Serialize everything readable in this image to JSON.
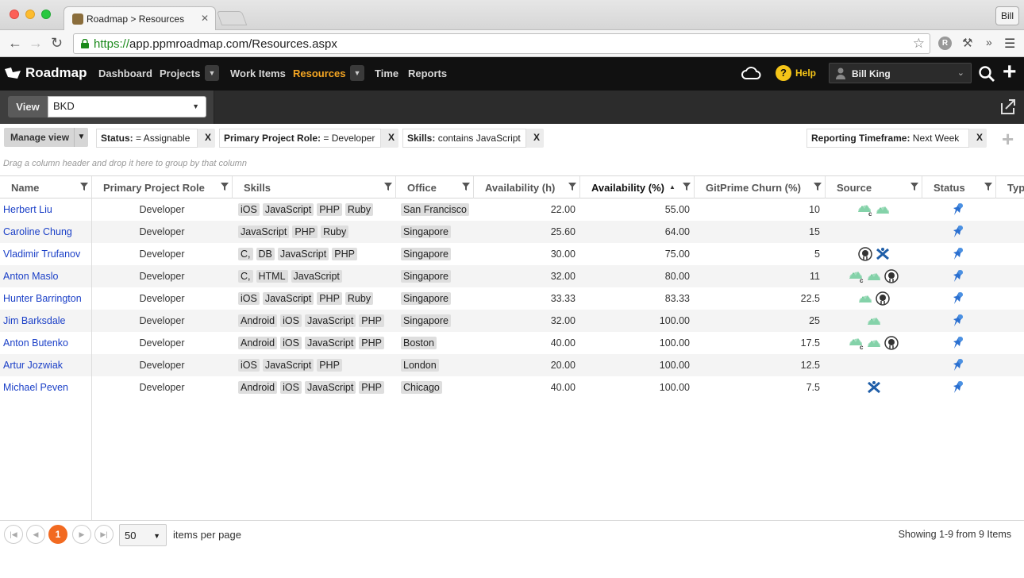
{
  "browser": {
    "tab_title": "Roadmap > Resources",
    "tab_close": "✕",
    "profile": "Bill",
    "url_scheme": "https://",
    "url_rest": "app.ppmroadmap.com/Resources.aspx",
    "ext_badge": "R"
  },
  "app": {
    "logo_text": "Roadmap",
    "nav": [
      {
        "label": "Dashboard"
      },
      {
        "label": "Projects"
      },
      {
        "label": "Work Items"
      },
      {
        "label": "Resources"
      },
      {
        "label": "Time"
      },
      {
        "label": "Reports"
      }
    ],
    "help_label": "Help",
    "user_name": "Bill King",
    "accent": "#f5a623"
  },
  "viewbar": {
    "label": "View",
    "selected": "BKD"
  },
  "filters": {
    "manage_label": "Manage view",
    "chips": [
      {
        "key": "Status:",
        "value": " = Assignable",
        "close": "X"
      },
      {
        "key": "Primary Project Role:",
        "value": " = Developer",
        "close": "X"
      },
      {
        "key": "Skills:",
        "value": " contains JavaScript",
        "close": "X"
      },
      {
        "key": "Reporting Timeframe:",
        "value": " Next Week",
        "close": "X"
      }
    ],
    "group_hint": "Drag a column header and drop it here to group by that column"
  },
  "grid": {
    "columns": [
      "Name",
      "Primary Project Role",
      "Skills",
      "Office",
      "Availability (h)",
      "Availability (%)",
      "GitPrime Churn (%)",
      "Source",
      "Status",
      "Typ"
    ],
    "sort_arrow": "▲",
    "rows": [
      {
        "name": "Herbert Liu",
        "role": "Developer",
        "skills": [
          "iOS",
          "JavaScript",
          "PHP",
          "Ruby"
        ],
        "office": "San Francisco",
        "avh": "22.00",
        "avp": "55.00",
        "churn": "10",
        "sources": [
          "cloud-c",
          "cloud"
        ]
      },
      {
        "name": "Caroline Chung",
        "role": "Developer",
        "skills": [
          "JavaScript",
          "PHP",
          "Ruby"
        ],
        "office": "Singapore",
        "avh": "25.60",
        "avp": "64.00",
        "churn": "15",
        "sources": []
      },
      {
        "name": "Vladimir Trufanov",
        "role": "Developer",
        "skills": [
          "C,",
          "DB",
          "JavaScript",
          "PHP"
        ],
        "office": "Singapore",
        "avh": "30.00",
        "avp": "75.00",
        "churn": "5",
        "sources": [
          "github",
          "atlassian"
        ]
      },
      {
        "name": "Anton Maslo",
        "role": "Developer",
        "skills": [
          "C,",
          "HTML",
          "JavaScript"
        ],
        "office": "Singapore",
        "avh": "32.00",
        "avp": "80.00",
        "churn": "11",
        "sources": [
          "cloud-c",
          "cloud",
          "github"
        ]
      },
      {
        "name": "Hunter Barrington",
        "role": "Developer",
        "skills": [
          "iOS",
          "JavaScript",
          "PHP",
          "Ruby"
        ],
        "office": "Singapore",
        "avh": "33.33",
        "avp": "83.33",
        "churn": "22.5",
        "sources": [
          "cloud",
          "github"
        ]
      },
      {
        "name": "Jim Barksdale",
        "role": "Developer",
        "skills": [
          "Android",
          "iOS",
          "JavaScript",
          "PHP"
        ],
        "office": "Singapore",
        "avh": "32.00",
        "avp": "100.00",
        "churn": "25",
        "sources": [
          "cloud"
        ]
      },
      {
        "name": "Anton Butenko",
        "role": "Developer",
        "skills": [
          "Android",
          "iOS",
          "JavaScript",
          "PHP"
        ],
        "office": "Boston",
        "avh": "40.00",
        "avp": "100.00",
        "churn": "17.5",
        "sources": [
          "cloud-c",
          "cloud",
          "github"
        ]
      },
      {
        "name": "Artur Jozwiak",
        "role": "Developer",
        "skills": [
          "iOS",
          "JavaScript",
          "PHP"
        ],
        "office": "London",
        "avh": "20.00",
        "avp": "100.00",
        "churn": "12.5",
        "sources": []
      },
      {
        "name": "Michael Peven",
        "role": "Developer",
        "skills": [
          "Android",
          "iOS",
          "JavaScript",
          "PHP"
        ],
        "office": "Chicago",
        "avh": "40.00",
        "avp": "100.00",
        "churn": "7.5",
        "sources": [
          "atlassian"
        ]
      }
    ]
  },
  "pager": {
    "current_page": "1",
    "page_size": "50",
    "per_page_label": "items per page",
    "summary": "Showing 1-9 from 9 Items",
    "current_color": "#f26a21"
  }
}
